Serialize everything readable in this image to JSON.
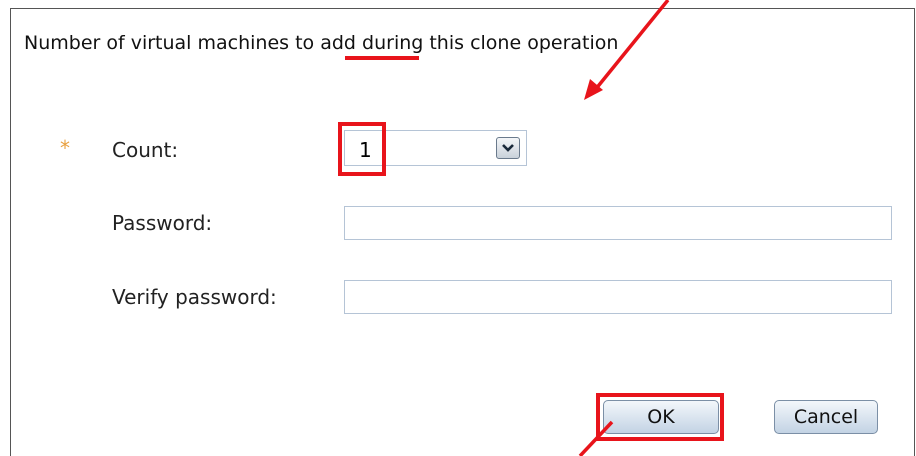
{
  "dialog": {
    "description": {
      "before": "Number of virtual machines ",
      "highlight": "to add",
      "after": " during this clone operation"
    },
    "required_marker": "*",
    "fields": {
      "count": {
        "label": "Count:",
        "value": "1"
      },
      "password": {
        "label": "Password:",
        "value": ""
      },
      "verify_password": {
        "label": "Verify password:",
        "value": ""
      }
    },
    "buttons": {
      "ok": "OK",
      "cancel": "Cancel"
    }
  },
  "icons": {
    "dropdown": "chevron-down-icon"
  },
  "colors": {
    "annotation": "#e8141b",
    "required": "#e8a040",
    "input_border": "#b5c4d6"
  }
}
